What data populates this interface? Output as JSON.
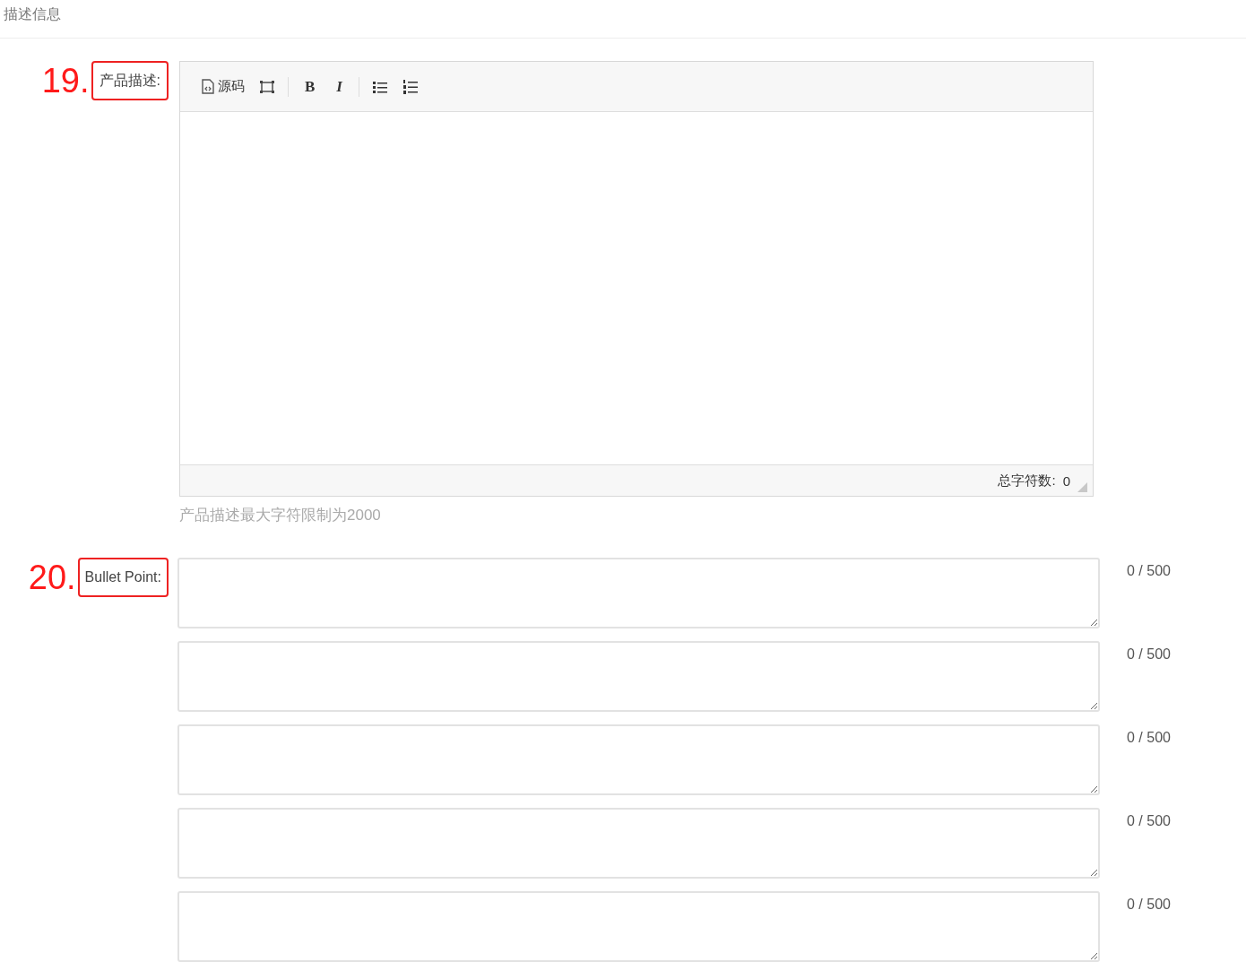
{
  "section_title": "描述信息",
  "description": {
    "number": "19.",
    "label": "产品描述:",
    "toolbar": [
      {
        "kind": "source",
        "label": "源码"
      },
      {
        "kind": "fullscreen"
      },
      {
        "kind": "separator"
      },
      {
        "kind": "bold",
        "label": "B"
      },
      {
        "kind": "italic",
        "label": "I"
      },
      {
        "kind": "separator"
      },
      {
        "kind": "bullet-list"
      },
      {
        "kind": "numbered-list"
      }
    ],
    "char_count_label": "总字符数:",
    "char_count": "0",
    "hint": "产品描述最大字符限制为2000"
  },
  "bullet_points": {
    "number": "20.",
    "label": "Bullet Point:",
    "fields": [
      {
        "counter": "0 / 500"
      },
      {
        "counter": "0 / 500"
      },
      {
        "counter": "0 / 500"
      },
      {
        "counter": "0 / 500"
      },
      {
        "counter": "0 / 500"
      }
    ]
  }
}
